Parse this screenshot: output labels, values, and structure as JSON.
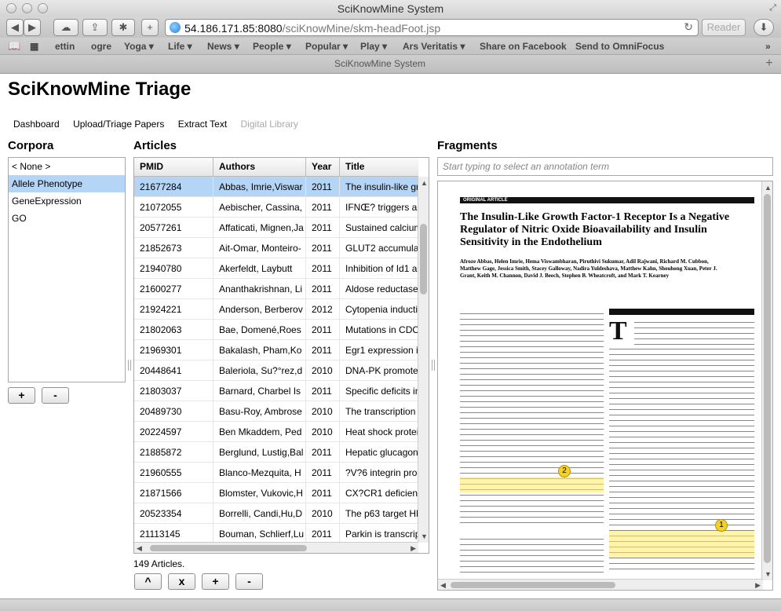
{
  "browser": {
    "window_title": "SciKnowMine System",
    "url_host": "54.186.171.85:8080",
    "url_path": "/sciKnowMine/skm-headFoot.jsp",
    "reader_label": "Reader",
    "tab_title": "SciKnowMine System",
    "bookmarks": [
      {
        "label": "ettin",
        "dropdown": false
      },
      {
        "label": "ogre",
        "dropdown": false
      },
      {
        "label": "Yoga",
        "dropdown": true
      },
      {
        "label": "Life",
        "dropdown": true
      },
      {
        "label": "News",
        "dropdown": true
      },
      {
        "label": "People",
        "dropdown": true
      },
      {
        "label": "Popular",
        "dropdown": true
      },
      {
        "label": "Play",
        "dropdown": true
      },
      {
        "label": "Ars Veritatis",
        "dropdown": true
      },
      {
        "label": "Share on Facebook",
        "dropdown": false
      },
      {
        "label": "Send to OmniFocus",
        "dropdown": false
      }
    ]
  },
  "page": {
    "title": "SciKnowMine Triage",
    "nav": [
      "Dashboard",
      "Upload/Triage Papers",
      "Extract Text",
      "Digital Library"
    ]
  },
  "corpora": {
    "heading": "Corpora",
    "items": [
      "< None >",
      "Allele Phenotype",
      "GeneExpression",
      "GO"
    ],
    "selected": 1,
    "add_label": "+",
    "remove_label": "-"
  },
  "articles": {
    "heading": "Articles",
    "columns": [
      "PMID",
      "Authors",
      "Year",
      "Title"
    ],
    "rows": [
      [
        "21677284",
        "Abbas, Imrie,Viswar",
        "2011",
        "The insulin-like gr"
      ],
      [
        "21072055",
        "Aebischer, Cassina,",
        "2011",
        "IFNŒ? triggers a"
      ],
      [
        "20577261",
        "Affaticati, Mignen,Ja",
        "2011",
        "Sustained calcium"
      ],
      [
        "21852673",
        "Ait-Omar, Monteiro-",
        "2011",
        "GLUT2 accumula"
      ],
      [
        "21940780",
        "Akerfeldt, Laybutt",
        "2011",
        "Inhibition of Id1 au"
      ],
      [
        "21600277",
        "Ananthakrishnan, Li",
        "2011",
        "Aldose reductase"
      ],
      [
        "21924221",
        "Anderson, Berberov",
        "2012",
        "Cytopenia inducti"
      ],
      [
        "21802063",
        "Bae, Domené,Roes",
        "2011",
        "Mutations in CDO"
      ],
      [
        "21969301",
        "Bakalash, Pham,Ko",
        "2011",
        "Egr1 expression is"
      ],
      [
        "20448641",
        "Baleriola, Su?°rez,d",
        "2010",
        "DNA-PK promote"
      ],
      [
        "21803037",
        "Barnard, Charbel Is",
        "2011",
        "Specific deficits in"
      ],
      [
        "20489730",
        "Basu-Roy, Ambrose",
        "2010",
        "The transcription"
      ],
      [
        "20224597",
        "Ben Mkaddem, Ped",
        "2010",
        "Heat shock protei"
      ],
      [
        "21885872",
        "Berglund, Lustig,Bal",
        "2011",
        "Hepatic glucagon"
      ],
      [
        "21960555",
        "Blanco-Mezquita, H",
        "2011",
        "?V?6 integrin pror"
      ],
      [
        "21871566",
        "Blomster, Vukovic,H",
        "2011",
        "CX?CR1 deficienc"
      ],
      [
        "20523354",
        "Borrelli, Candi,Hu,D",
        "2010",
        "The p63 target HE"
      ],
      [
        "21113145",
        "Bouman, Schlierf,Lu",
        "2011",
        "Parkin is transcrip"
      ]
    ],
    "selected": 0,
    "count_text": "149 Articles.",
    "buttons": [
      "^",
      "x",
      "+",
      "-"
    ]
  },
  "fragments": {
    "heading": "Fragments",
    "annotation_placeholder": "Start typing to select an annotation term",
    "paper": {
      "band_label": "ORIGINAL ARTICLE",
      "title": "The Insulin-Like Growth Factor-1 Receptor Is a Negative Regulator of Nitric Oxide Bioavailability and Insulin Sensitivity in the Endothelium",
      "authors": "Afroze Abbas, Helen Imrie, Hema Viswambharan, Piruthivi Sukumar, Adil Rajwani, Richard M. Cubbon, Matthew Gage, Jessica Smith, Stacey Galloway, Nadira Yuldeshava, Matthew Kahn, Shouhong Xuan, Peter J. Grant, Keith M. Channon, David J. Beech, Stephen B. Wheatcroft, and Mark T. Kearney",
      "markers": [
        "1",
        "2"
      ]
    }
  }
}
